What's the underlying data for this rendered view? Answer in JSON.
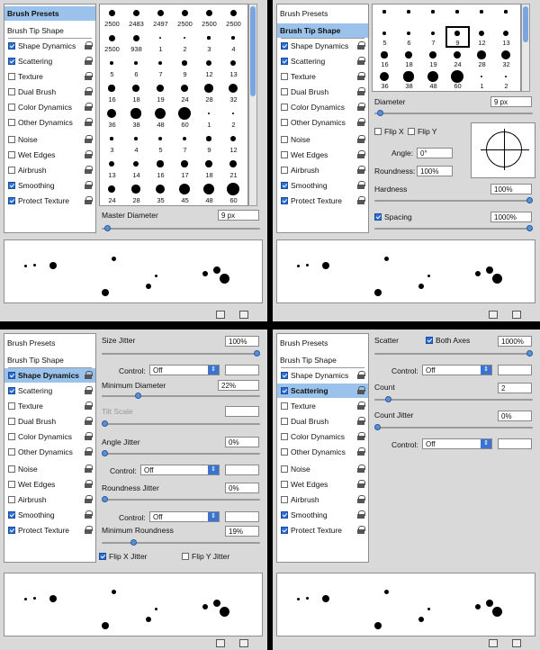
{
  "panels": [
    {
      "selected": "Brush Presets",
      "checks": {
        "shape_dynamics": true,
        "scattering": true,
        "texture": false,
        "dual_brush": false,
        "color_dynamics": false,
        "other_dynamics": false,
        "noise": false,
        "wet_edges": false,
        "airbrush": false,
        "smoothing": true,
        "protect_texture": true
      }
    },
    {
      "selected": "Brush Tip Shape",
      "checks": {
        "shape_dynamics": true,
        "scattering": true,
        "texture": false,
        "dual_brush": false,
        "color_dynamics": false,
        "other_dynamics": false,
        "noise": false,
        "wet_edges": false,
        "airbrush": false,
        "smoothing": true,
        "protect_texture": true
      }
    },
    {
      "selected": "Shape Dynamics",
      "checks": {
        "shape_dynamics": true,
        "scattering": true,
        "texture": false,
        "dual_brush": false,
        "color_dynamics": false,
        "other_dynamics": false,
        "noise": false,
        "wet_edges": false,
        "airbrush": false,
        "smoothing": true,
        "protect_texture": true
      }
    },
    {
      "selected": "Scattering",
      "checks": {
        "shape_dynamics": true,
        "scattering": true,
        "texture": false,
        "dual_brush": false,
        "color_dynamics": false,
        "other_dynamics": false,
        "noise": false,
        "wet_edges": false,
        "airbrush": false,
        "smoothing": true,
        "protect_texture": true
      }
    }
  ],
  "sidebar": {
    "brush_presets": "Brush Presets",
    "brush_tip_shape": "Brush Tip Shape",
    "shape_dynamics": "Shape Dynamics",
    "scattering": "Scattering",
    "texture": "Texture",
    "dual_brush": "Dual Brush",
    "color_dynamics": "Color Dynamics",
    "other_dynamics": "Other Dynamics",
    "noise": "Noise",
    "wet_edges": "Wet Edges",
    "airbrush": "Airbrush",
    "smoothing": "Smoothing",
    "protect_texture": "Protect Texture"
  },
  "presets": {
    "rows": [
      [
        "2500",
        "2483",
        "2497",
        "2500",
        "2500",
        "2500"
      ],
      [
        "2500",
        "938",
        "1",
        "2",
        "3",
        "4"
      ],
      [
        "5",
        "6",
        "7",
        "9",
        "12",
        "13"
      ],
      [
        "16",
        "18",
        "19",
        "24",
        "28",
        "32"
      ],
      [
        "36",
        "38",
        "48",
        "60",
        "1",
        "2"
      ],
      [
        "3",
        "4",
        "5",
        "7",
        "9",
        "12"
      ],
      [
        "13",
        "14",
        "16",
        "17",
        "18",
        "21"
      ],
      [
        "24",
        "28",
        "35",
        "45",
        "48",
        "60"
      ]
    ],
    "master_diameter_label": "Master Diameter",
    "master_diameter_value": "9 px",
    "master_diameter_level": 0.02
  },
  "tip_shape": {
    "rows": [
      [
        "",
        "",
        "",
        "",
        "",
        ""
      ],
      [
        "5",
        "6",
        "7",
        "9",
        "12",
        "13"
      ],
      [
        "16",
        "18",
        "19",
        "24",
        "28",
        "32"
      ],
      [
        "36",
        "38",
        "48",
        "60",
        "1",
        "2"
      ]
    ],
    "diameter_label": "Diameter",
    "diameter_value": "9 px",
    "diameter_level": 0.02,
    "flip_x": "Flip X",
    "flip_y": "Flip Y",
    "angle_label": "Angle:",
    "angle_value": "0°",
    "roundness_label": "Roundness:",
    "roundness_value": "100%",
    "hardness_label": "Hardness",
    "hardness_value": "100%",
    "hardness_level": 1.0,
    "spacing_label": "Spacing",
    "spacing_value": "1000%",
    "spacing_level": 1.0
  },
  "shape_dynamics": {
    "size_jitter_label": "Size Jitter",
    "size_jitter_value": "100%",
    "size_jitter_level": 1.0,
    "control_label": "Control:",
    "control_value": "Off",
    "min_diameter_label": "Minimum Diameter",
    "min_diameter_value": "22%",
    "min_diameter_level": 0.22,
    "tilt_scale_label": "Tilt Scale",
    "angle_jitter_label": "Angle Jitter",
    "angle_jitter_value": "0%",
    "angle_control_label": "Control:",
    "angle_control_value": "Off",
    "roundness_jitter_label": "Roundness Jitter",
    "roundness_jitter_value": "0%",
    "roundness_control_label": "Control:",
    "roundness_control_value": "Off",
    "min_roundness_label": "Minimum Roundness",
    "min_roundness_value": "19%",
    "min_roundness_level": 0.19,
    "flip_x_jitter": "Flip X Jitter",
    "flip_y_jitter": "Flip Y Jitter"
  },
  "scattering": {
    "scatter_label": "Scatter",
    "both_axes_label": "Both Axes",
    "scatter_value": "1000%",
    "scatter_level": 1.0,
    "control_label": "Control:",
    "control_value": "Off",
    "count_label": "Count",
    "count_value": "2",
    "count_level": 0.07,
    "count_jitter_label": "Count Jitter",
    "count_jitter_value": "0%",
    "count_jitter_level": 0.0,
    "count_control_label": "Control:",
    "count_control_value": "Off"
  },
  "colors": {
    "selection": "#9bc2ea",
    "accent": "#2b6fd6",
    "panel": "#d9d9d9"
  }
}
